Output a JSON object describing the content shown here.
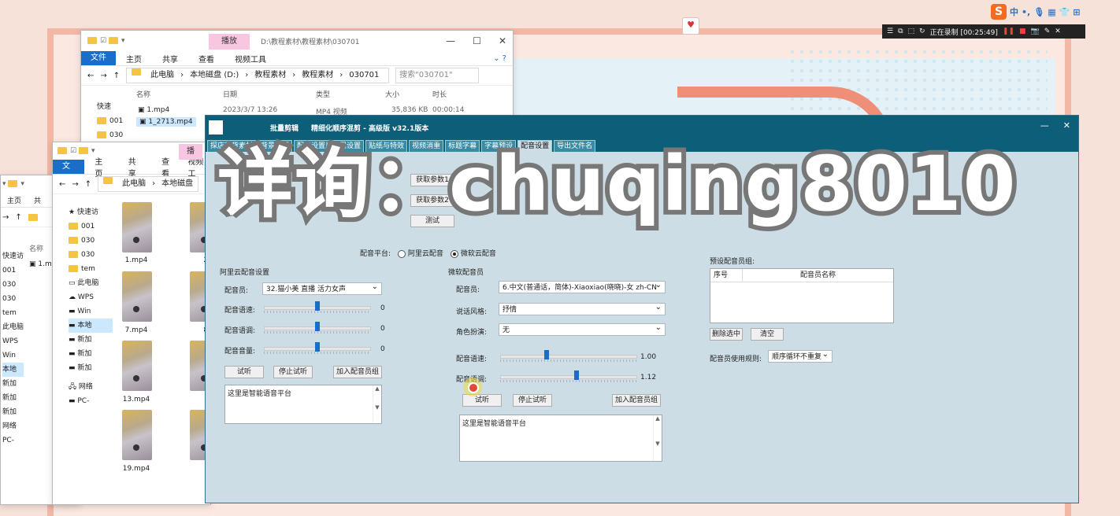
{
  "tray": {
    "ime_logo": "S",
    "ime_lang": "中",
    "rec_status": "正在录制 [00:25:49]"
  },
  "explorer_back": {
    "ctx_tab": "播放",
    "path_title": "D:\\教程素材\\教程素材\\030701",
    "ctx_tools": "视频工具",
    "ribbon": [
      "文件",
      "主页",
      "共享",
      "查看"
    ],
    "breadcrumb": [
      "此电脑",
      "本地磁盘 (D:)",
      "教程素材",
      "教程素材",
      "030701"
    ],
    "search_placeholder": "搜索\"030701\"",
    "columns": [
      "名称",
      "日期",
      "类型",
      "大小",
      "时长"
    ],
    "nav": [
      "快速",
      "001",
      "030",
      "030"
    ],
    "rows": [
      {
        "name": "1.mp4",
        "date": "2023/3/7 13:26",
        "type": "MP4 视频",
        "size": "35,836 KB",
        "dur": "00:00:14"
      },
      {
        "name": "1_2713.mp4"
      }
    ]
  },
  "explorer_mid": {
    "ctx_tab": "播",
    "ribbon": [
      "文件",
      "主页",
      "共享",
      "查看",
      "视频工"
    ],
    "breadcrumb": [
      "此电脑",
      "本地磁盘"
    ],
    "nav": [
      "快速访",
      "001",
      "030",
      "030",
      "tem",
      "此电脑",
      "WPS",
      "Win",
      "本地",
      "新加",
      "新加",
      "新加",
      "网络",
      "PC-"
    ],
    "thumbs": [
      "1.mp4",
      "2.m",
      "7.mp4",
      "8.m",
      "13.mp4",
      "14.",
      "19.mp4",
      "20."
    ]
  },
  "explorer_left": {
    "ribbon": [
      "主页",
      "共"
    ],
    "nav": [
      "快速访",
      "001",
      "030",
      "030",
      "tem",
      "此电脑",
      "WPS",
      "Win",
      "本地",
      "新加",
      "新加",
      "新加",
      "网络",
      "PC-"
    ],
    "col": "名称",
    "file": "1.m"
  },
  "app": {
    "title_left": "批量剪辑",
    "title_main": "精细化顺序混剪 - 高级版  v32.1版本",
    "tabs": [
      "探店带货素材",
      "背景设置",
      "配音设置片头尾设置",
      "贴纸与特效",
      "视频消重",
      "标题字幕",
      "字幕预设",
      "配音设置",
      "导出文件名"
    ],
    "active_tab": 7,
    "top_buttons": [
      "获取参数1",
      "获取参数2",
      "测试"
    ],
    "platform_label": "配音平台:",
    "platform_opts": [
      "阿里云配音",
      "微软云配音"
    ],
    "aliyun": {
      "title": "阿里云配音设置",
      "voice_label": "配音员:",
      "voice": "32.猫小美 直播 活力女声",
      "speed_label": "配音语速:",
      "speed_value": "0",
      "speed_pos": 0.5,
      "pitch_label": "配音语调:",
      "pitch_value": "0",
      "pitch_pos": 0.5,
      "volume_label": "配音音量:",
      "volume_value": "0",
      "volume_pos": 0.5,
      "btn_listen": "试听",
      "btn_stop": "停止试听",
      "btn_add": "加入配音员组",
      "text": "这里是智能语音平台"
    },
    "ms": {
      "title": "微软配音员",
      "voice_label": "配音员:",
      "voice": "6.中文(普通话，简体)-Xiaoxiao(晓晓)-女 zh-CN",
      "style_label": "说话风格:",
      "style": "抒情",
      "role_label": "角色扮演:",
      "role": "无",
      "speed_label": "配音语速:",
      "speed_value": "1.00",
      "speed_pos": 0.34,
      "pitch_label": "配音语调:",
      "pitch_value": "1.12",
      "pitch_pos": 0.56,
      "btn_listen": "试听",
      "btn_stop": "停止试听",
      "btn_add": "加入配音员组",
      "text": "这里是智能语音平台"
    },
    "preset": {
      "title": "预设配音员组:",
      "col_no": "序号",
      "col_name": "配音员名称",
      "btn_delete": "删除选中",
      "btn_clear": "清空",
      "rule_label": "配音员使用规则:",
      "rule": "顺序循环不重复"
    }
  },
  "watermark": "详询：chuqing8010"
}
